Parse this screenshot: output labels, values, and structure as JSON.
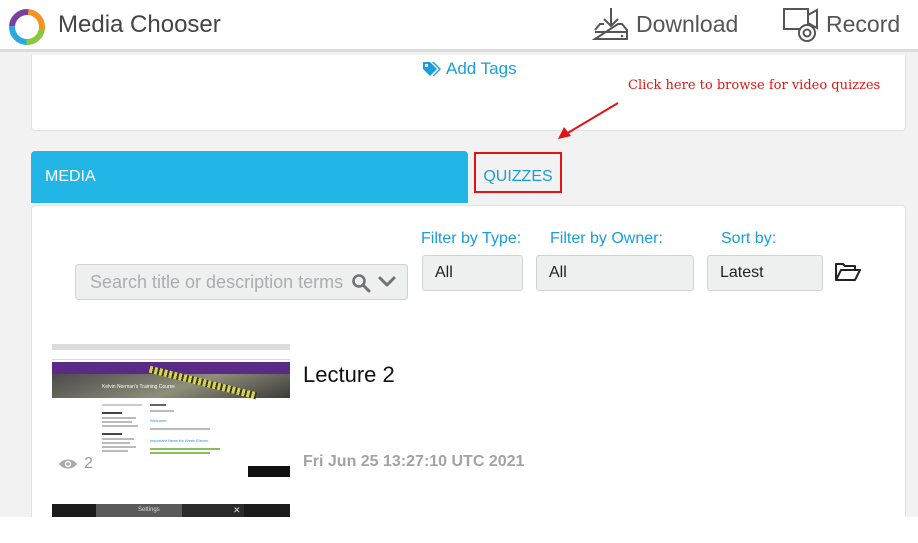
{
  "app": {
    "title": "Media Chooser"
  },
  "header": {
    "download_label": "Download",
    "record_label": "Record"
  },
  "top_card": {
    "add_tags_label": "Add Tags"
  },
  "annotation": {
    "text": "Click here to browse for video quizzes",
    "color": "#e01414"
  },
  "tabs": [
    {
      "label": "MEDIA",
      "active": true
    },
    {
      "label": "QUIZZES",
      "active": false
    }
  ],
  "filters": {
    "type": {
      "label": "Filter by Type:",
      "value": "All"
    },
    "owner": {
      "label": "Filter by Owner:",
      "value": "All"
    },
    "sort": {
      "label": "Sort by:",
      "value": "Latest"
    }
  },
  "search": {
    "placeholder": "Search title or description terms",
    "value": ""
  },
  "entries": [
    {
      "title": "Lecture 2",
      "views": "2",
      "date": "Fri Jun 25 13:27:10 UTC 2021",
      "thumbnail": {
        "banner": "Kelvin Norman's Training Course",
        "section1": "Welcome",
        "section2": "Important News for Week Eleven"
      }
    },
    {
      "thumbnail": {
        "dialog_title": "Settings"
      }
    }
  ],
  "colors": {
    "accent": "#21b6e6",
    "link": "#1a9ed8",
    "annotation": "#e01414"
  },
  "icons": [
    "logo-icon",
    "download-icon",
    "record-icon",
    "tag-icon",
    "search-icon",
    "chevron-down-icon",
    "folder-open-icon",
    "eye-icon",
    "close-icon"
  ]
}
